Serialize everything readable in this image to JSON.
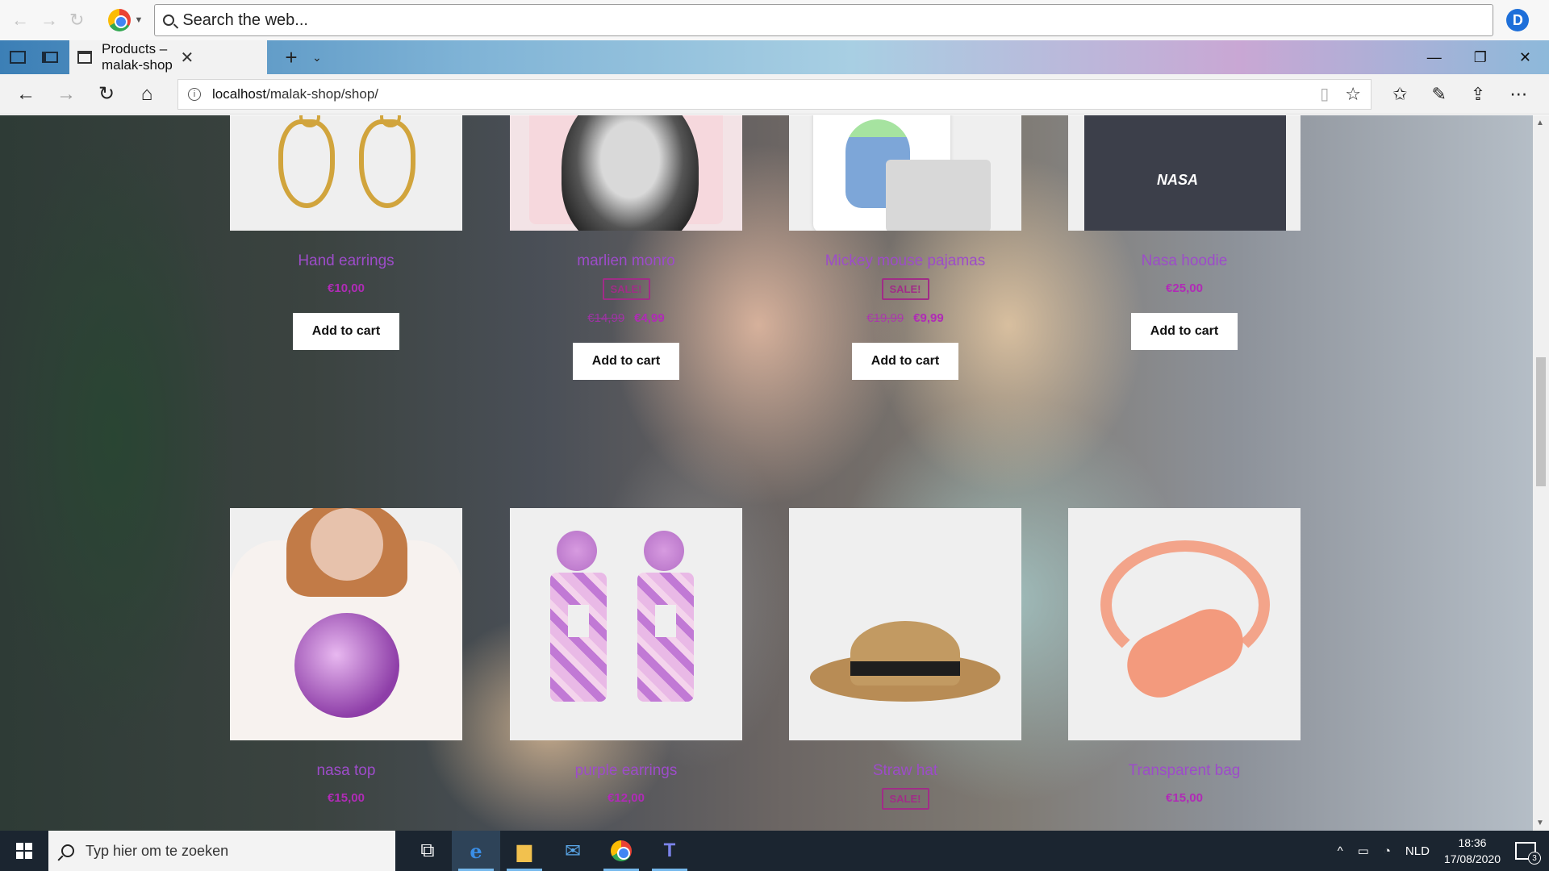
{
  "searchbar": {
    "placeholder": "Search the web...",
    "profile_initial": "D"
  },
  "tab": {
    "title": "Products – malak-shop"
  },
  "address": {
    "host": "localhost",
    "path": "/malak-shop/shop/"
  },
  "products": [
    {
      "name": "Hand earrings",
      "price": "€10,00",
      "old_price": "",
      "sale": "",
      "button": "Add to cart"
    },
    {
      "name": "marlien monro",
      "price": "€4,99",
      "old_price": "€14,99",
      "sale": "SALE!",
      "button": "Add to cart"
    },
    {
      "name": "Mickey mouse pajamas",
      "price": "€9,99",
      "old_price": "€19,99",
      "sale": "SALE!",
      "button": "Add to cart"
    },
    {
      "name": "Nasa hoodie",
      "price": "€25,00",
      "old_price": "",
      "sale": "",
      "button": "Add to cart"
    },
    {
      "name": "nasa top",
      "price": "€15,00",
      "old_price": "",
      "sale": "",
      "button": ""
    },
    {
      "name": "purple earrings",
      "price": "€12,00",
      "old_price": "",
      "sale": "",
      "button": ""
    },
    {
      "name": "Straw hat",
      "price": "",
      "old_price": "",
      "sale": "SALE!",
      "button": ""
    },
    {
      "name": "Transparent bag",
      "price": "€15,00",
      "old_price": "",
      "sale": "",
      "button": ""
    }
  ],
  "taskbar": {
    "search_placeholder": "Typ hier om te zoeken",
    "language": "NLD",
    "time": "18:36",
    "date": "17/08/2020",
    "notifications": "3"
  }
}
